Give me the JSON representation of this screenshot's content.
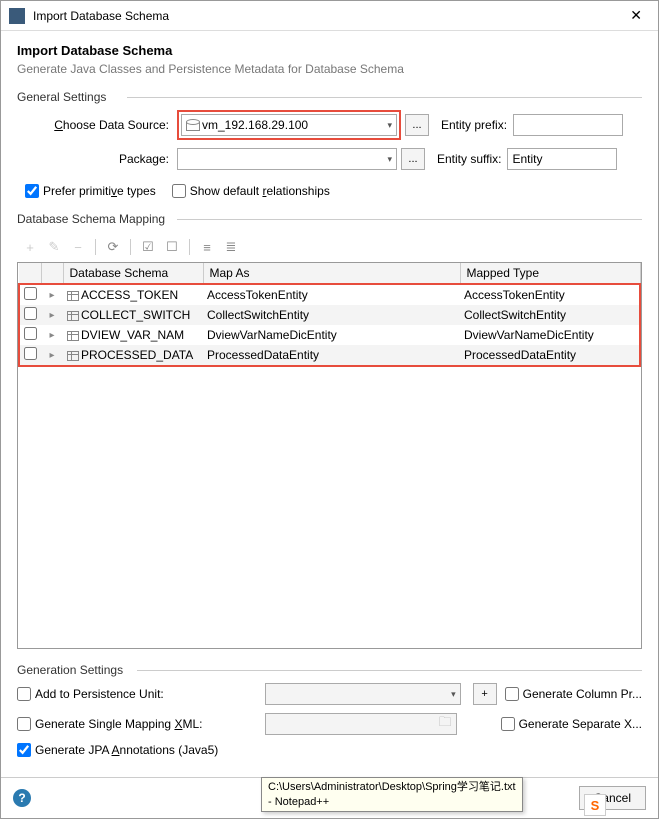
{
  "window": {
    "title": "Import Database Schema"
  },
  "header": {
    "title": "Import Database Schema",
    "subtitle": "Generate Java Classes and Persistence Metadata for Database Schema"
  },
  "sections": {
    "general": "General Settings",
    "mapping": "Database Schema Mapping",
    "generation": "Generation Settings"
  },
  "labels": {
    "data_source": "Choose Data Source:",
    "package": "Package:",
    "entity_prefix": "Entity prefix:",
    "entity_suffix": "Entity suffix:"
  },
  "values": {
    "data_source": "vm_192.168.29.100",
    "package": "",
    "entity_prefix": "",
    "entity_suffix": "Entity"
  },
  "checkboxes": {
    "prefer_primitive": {
      "label_pre": "Prefer primiti",
      "label_u": "v",
      "label_post": "e types",
      "checked": true
    },
    "show_default_rel": {
      "label_pre": "Show default ",
      "label_u": "r",
      "label_post": "elationships",
      "checked": false
    }
  },
  "columns": {
    "schema": "Database Schema",
    "map_as": "Map As",
    "mapped_type": "Mapped Type"
  },
  "rows": [
    {
      "schema": "ACCESS_TOKEN",
      "map_as": "AccessTokenEntity",
      "mapped_type": "AccessTokenEntity"
    },
    {
      "schema": "COLLECT_SWITCH",
      "map_as": "CollectSwitchEntity",
      "mapped_type": "CollectSwitchEntity"
    },
    {
      "schema": "DVIEW_VAR_NAM",
      "map_as": "DviewVarNameDicEntity",
      "mapped_type": "DviewVarNameDicEntity"
    },
    {
      "schema": "PROCESSED_DATA",
      "map_as": "ProcessedDataEntity",
      "mapped_type": "ProcessedDataEntity"
    }
  ],
  "gen": {
    "persistence_unit": {
      "label": "Add to Persistence Unit:",
      "checked": false
    },
    "gen_column": {
      "label": "Generate Column Pr...",
      "checked": false
    },
    "single_mapping": {
      "label_pre": "Generate Single Mapping ",
      "label_u": "X",
      "label_post": "ML:",
      "checked": false
    },
    "gen_separate": {
      "label": "Generate Separate X...",
      "checked": false
    },
    "jpa": {
      "label_pre": "Generate JPA ",
      "label_u": "A",
      "label_post": "nnotations (Java5)",
      "checked": true
    }
  },
  "tooltip": "C:\\Users\\Administrator\\Desktop\\Spring学习笔记.txt\n- Notepad++",
  "buttons": {
    "cancel": "Cancel",
    "browse": "..."
  }
}
